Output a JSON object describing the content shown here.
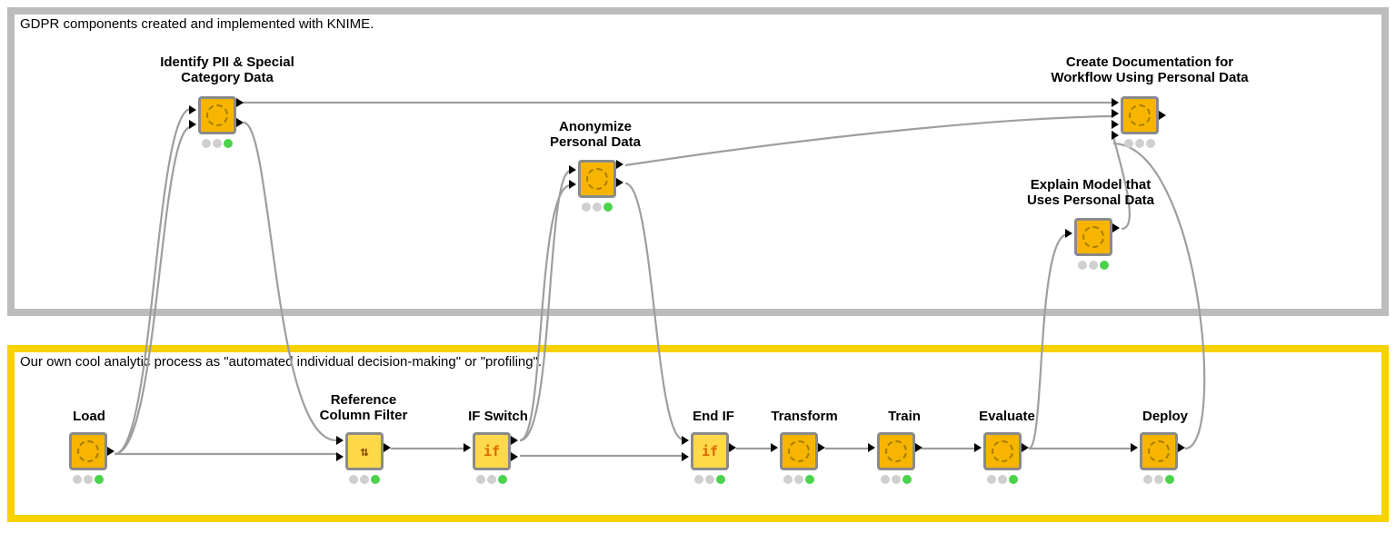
{
  "regions": {
    "top_caption": "GDPR components created and implemented with KNIME.",
    "bottom_caption": "Our own cool analytic process as \"automated individual decision-making\" or \"profiling\"."
  },
  "nodes": {
    "identify": {
      "label": "Identify PII & Special\nCategory Data",
      "status": "green"
    },
    "anonymize": {
      "label": "Anonymize\nPersonal Data",
      "status": "green"
    },
    "explain": {
      "label": "Explain Model that\nUses Personal Data",
      "status": "green"
    },
    "createdoc": {
      "label": "Create Documentation for\nWorkflow Using Personal Data",
      "status": "idle"
    },
    "load": {
      "label": "Load",
      "status": "green"
    },
    "refcol": {
      "label": "Reference\nColumn Filter",
      "status": "green"
    },
    "ifswitch": {
      "label": "IF Switch",
      "status": "green",
      "glyph": "if"
    },
    "endif": {
      "label": "End IF",
      "status": "green",
      "glyph": "if"
    },
    "transform": {
      "label": "Transform",
      "status": "green"
    },
    "train": {
      "label": "Train",
      "status": "green"
    },
    "evaluate": {
      "label": "Evaluate",
      "status": "green"
    },
    "deploy": {
      "label": "Deploy",
      "status": "green"
    }
  }
}
